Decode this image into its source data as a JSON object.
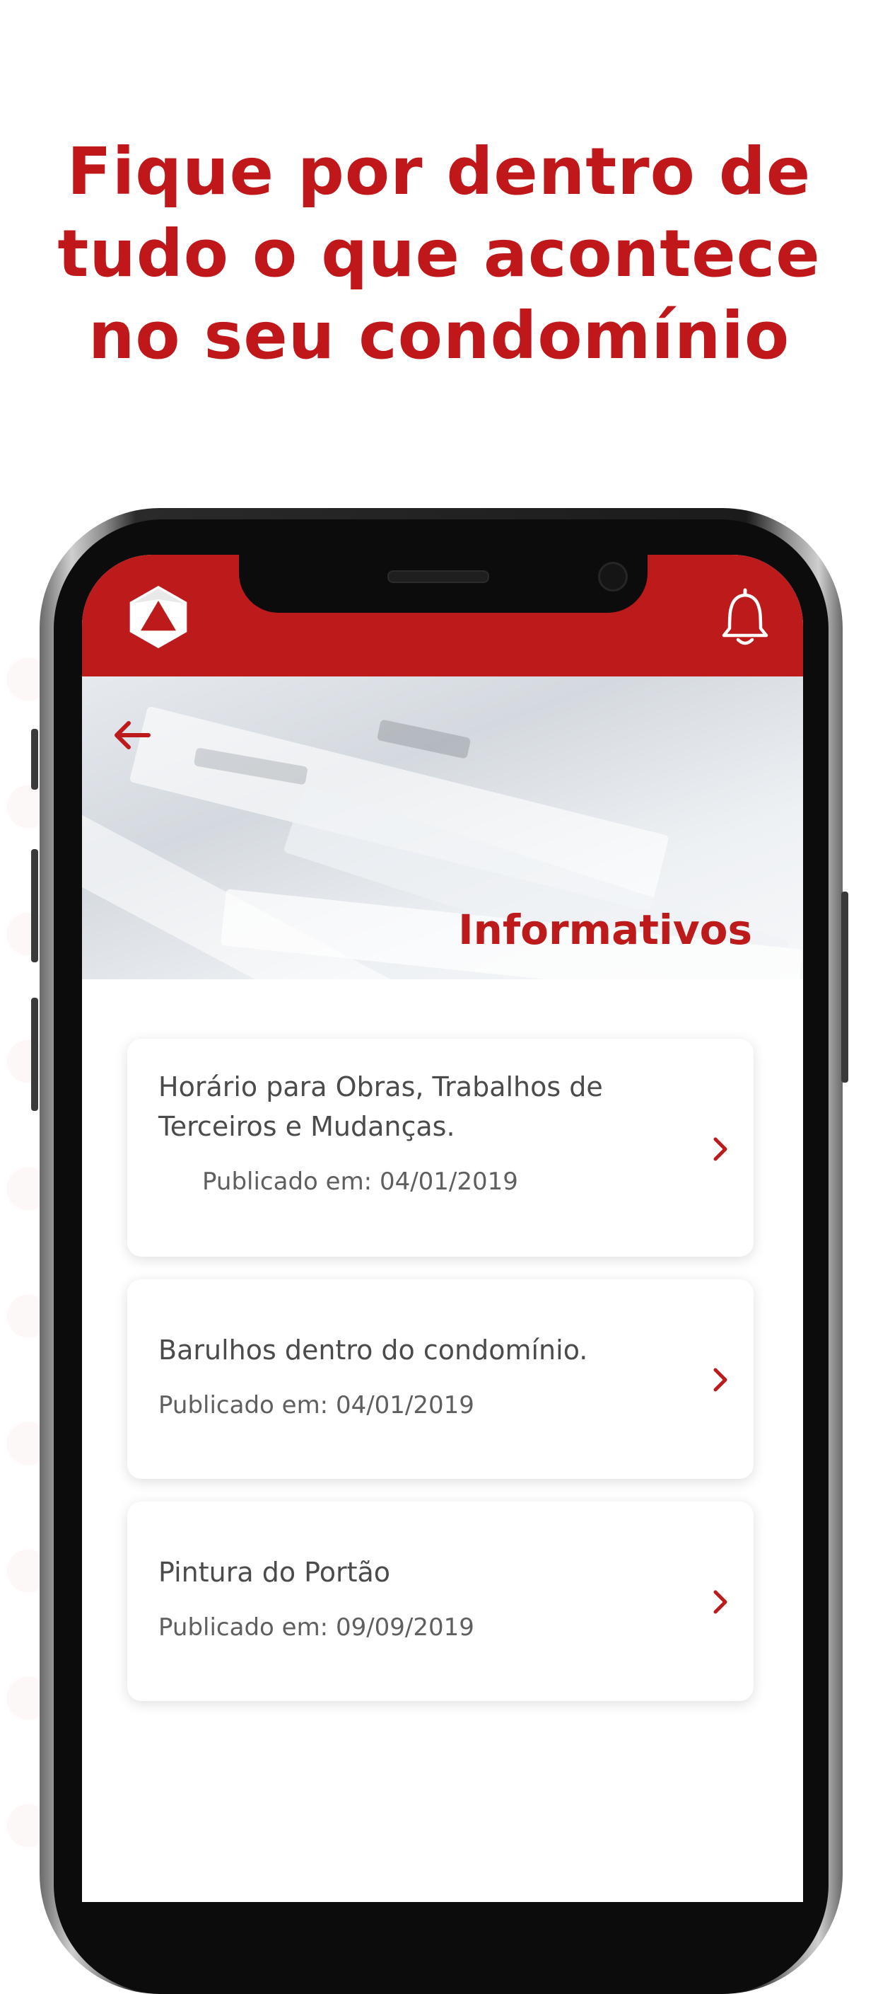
{
  "headline": {
    "lines": [
      "Fique por dentro de",
      "tudo o que acontece",
      "no seu condomínio"
    ]
  },
  "app": {
    "accent_color": "#bd1a1b",
    "logo_icon": "triangle-hexagon-logo",
    "notification_icon": "bell-icon",
    "back_icon": "arrow-left-icon",
    "page_title": "Informativos",
    "items": [
      {
        "title_line1": "Horário para Obras, Trabalhos de",
        "title_line2": "Terceiros e Mudanças.",
        "date": "Publicado em: 04/01/2019"
      },
      {
        "title_line1": "Barulhos dentro do condomínio.",
        "date": "Publicado em: 04/01/2019"
      },
      {
        "title_line1": "Pintura do Portão",
        "date": "Publicado em: 09/09/2019"
      }
    ]
  }
}
